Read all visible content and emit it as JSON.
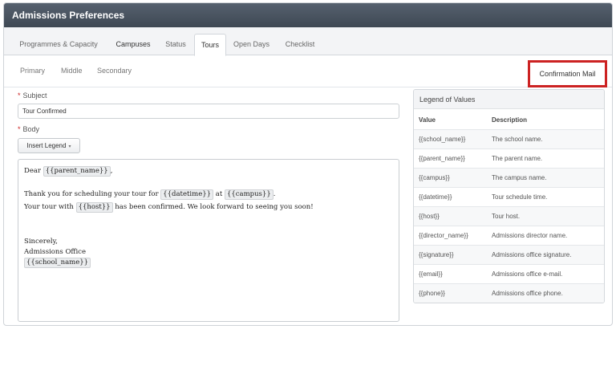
{
  "window": {
    "title": "Admissions Preferences"
  },
  "tabs": [
    "Programmes & Capacity",
    "Campuses",
    "Status",
    "Tours",
    "Open Days",
    "Checklist"
  ],
  "active_tab": "Tours",
  "subtabs": [
    "Primary",
    "Middle",
    "Secondary"
  ],
  "confirmation_tab": "Confirmation Mail",
  "form": {
    "required_mark": "*",
    "subject_label": "Subject",
    "subject_value": "Tour Confirmed",
    "body_label": "Body",
    "insert_legend_label": "Insert Legend",
    "insert_legend_caret": "▾"
  },
  "editor": {
    "line1_prefix": "Dear ",
    "line1_token": "{{parent_name}}",
    "line1_suffix": ",",
    "line2_prefix": "Thank you for scheduling your tour for ",
    "line2_token1": "{{datetime}}",
    "line2_mid": " at ",
    "line2_token2": "{{campus}}",
    "line2_suffix": ".",
    "line3_prefix": "Your tour with ",
    "line3_token": "{{host}}",
    "line3_suffix": " has been confirmed. We look forward to seeing you soon!",
    "sign_off": "Sincerely,",
    "office": "Admissions Office",
    "school_token": "{{school_name}}"
  },
  "legend": {
    "title": "Legend of Values",
    "col_value": "Value",
    "col_desc": "Description",
    "rows": [
      {
        "value": "{{school_name}}",
        "desc": "The school name."
      },
      {
        "value": "{{parent_name}}",
        "desc": "The parent name."
      },
      {
        "value": "{{campus}}",
        "desc": "The campus name."
      },
      {
        "value": "{{datetime}}",
        "desc": "Tour schedule time."
      },
      {
        "value": "{{host}}",
        "desc": "Tour host."
      },
      {
        "value": "{{director_name}}",
        "desc": "Admissions director name."
      },
      {
        "value": "{{signature}}",
        "desc": "Admissions office signature."
      },
      {
        "value": "{{email}}",
        "desc": "Admissions office e-mail."
      },
      {
        "value": "{{phone}}",
        "desc": "Admissions office phone."
      }
    ]
  },
  "colors": {
    "titlebar": "#4a5562",
    "highlight_border": "#cc2222",
    "required": "#cc2222"
  }
}
